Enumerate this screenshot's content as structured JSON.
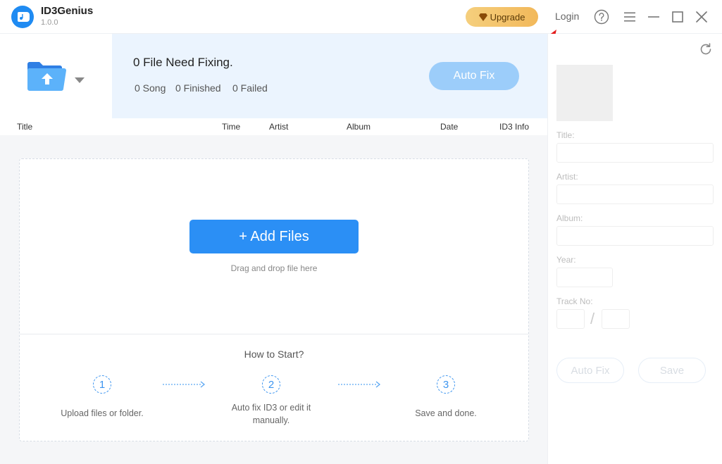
{
  "app": {
    "name": "ID3Genius",
    "version": "1.0.0",
    "upgrade_label": "Upgrade",
    "login_label": "Login"
  },
  "status": {
    "need_fixing": "0 File Need Fixing.",
    "song": "0 Song",
    "finished": "0 Finished",
    "failed": "0 Failed",
    "autofix_label": "Auto Fix"
  },
  "table": {
    "columns": [
      "Title",
      "Time",
      "Artist",
      "Album",
      "Date",
      "ID3 Info"
    ]
  },
  "dropzone": {
    "add_files_label": "+ Add Files",
    "drag_text": "Drag and drop file here",
    "howto_title": "How to Start?",
    "steps": [
      {
        "number": "1",
        "text": "Upload files or folder."
      },
      {
        "number": "2",
        "text": "Auto fix ID3 or edit it manually."
      },
      {
        "number": "3",
        "text": "Save and done."
      }
    ]
  },
  "editor": {
    "title_label": "Title:",
    "artist_label": "Artist:",
    "album_label": "Album:",
    "year_label": "Year:",
    "track_label": "Track No:",
    "track_separator": "/",
    "autofix_label": "Auto Fix",
    "save_label": "Save"
  },
  "colors": {
    "accent": "#2b8ff5",
    "status_bg": "#ebf4fe",
    "upgrade_gold": "#f2b85a"
  }
}
